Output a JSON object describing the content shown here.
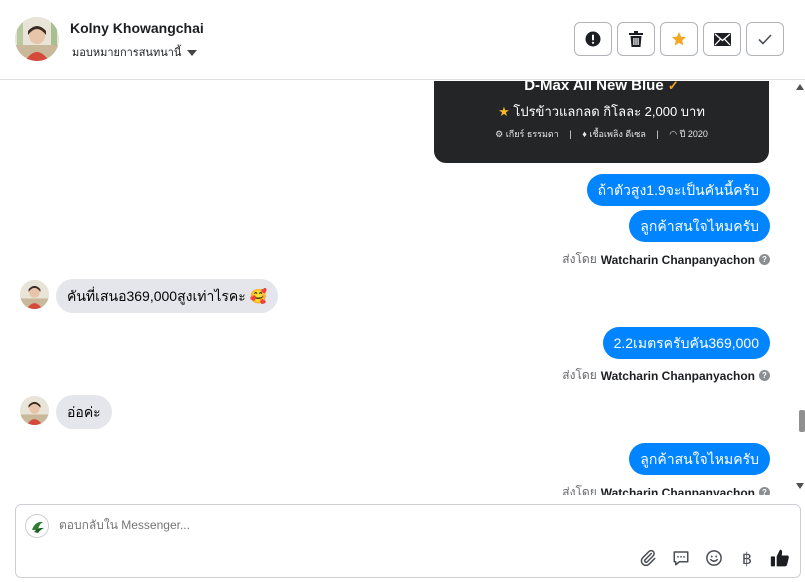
{
  "header": {
    "contact_name": "Kolny Khowangchai",
    "assign_label": "มอบหมายการสนทนานี้",
    "actions": [
      {
        "name": "report-button",
        "icon": "alert-icon"
      },
      {
        "name": "delete-button",
        "icon": "trash-icon"
      },
      {
        "name": "star-button",
        "icon": "star-icon"
      },
      {
        "name": "mail-button",
        "icon": "envelope-icon"
      },
      {
        "name": "done-button",
        "icon": "check-icon"
      }
    ]
  },
  "card": {
    "title": "D-Max All New Blue",
    "promo": "โปรข้าวแลกลด กิโลละ 2,000 บาท",
    "specs": [
      "เกียร์ ธรรมดา",
      "เชื้อเพลิง ดีเซล",
      "ปี 2020"
    ]
  },
  "messages": {
    "m1": "ถ้าตัวสูง1.9จะเป็นคันนี้ครับ",
    "m2": "ลูกค้าสนใจไหมครับ",
    "m3": "คันที่เสนอ369,000สูงเท่าไรคะ 🥰",
    "m4": "2.2เมตรครับคัน369,000",
    "m5": "อ่อค่ะ",
    "m6": "ลูกค้าสนใจไหมครับ"
  },
  "sent_by": {
    "prefix": "ส่งโดย",
    "name": "Watcharin Chanpanyachon"
  },
  "composer": {
    "placeholder": "ตอบกลับใน Messenger..."
  },
  "colors": {
    "outgoing_bubble": "#0084ff",
    "incoming_bubble": "#e4e6eb",
    "card_bg": "#242526",
    "star_accent": "#f5a623"
  }
}
